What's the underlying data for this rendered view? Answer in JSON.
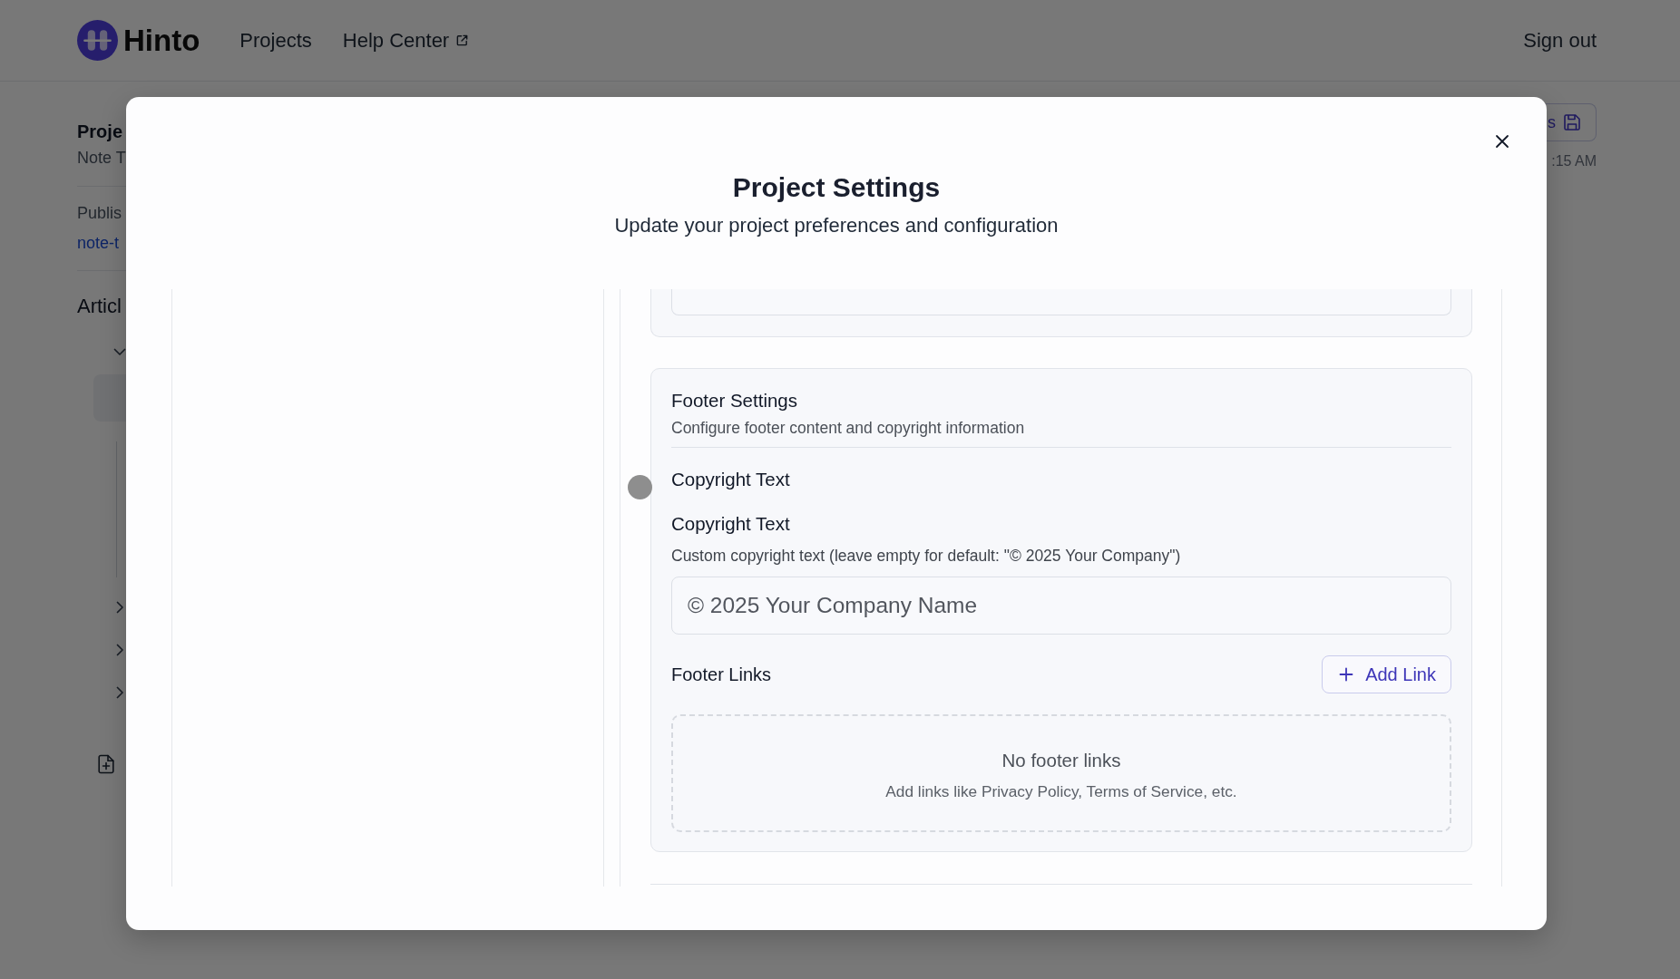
{
  "header": {
    "brand": "Hinto",
    "nav": [
      {
        "label": "Projects",
        "external": false
      },
      {
        "label": "Help Center",
        "external": true
      }
    ],
    "sign_out": "Sign out"
  },
  "background": {
    "sidebar": {
      "project_title": "Proje",
      "project_subtitle": "Note T",
      "published_label": "Publis",
      "published_link": "note-t",
      "articles_heading": "Articl",
      "tree": [
        {
          "expanded": true,
          "children": [
            {
              "selected": true
            }
          ]
        },
        {
          "expanded": false
        },
        {
          "expanded": false
        },
        {
          "expanded": false
        }
      ]
    },
    "save_button": "s",
    "last_saved": ":15 AM"
  },
  "modal": {
    "title": "Project Settings",
    "subtitle": "Update your project preferences and configuration",
    "footer_settings": {
      "title": "Footer Settings",
      "description": "Configure footer content and copyright information",
      "section_label": "Copyright Text",
      "copyright_field": {
        "label": "Copyright Text",
        "help": "Custom copyright text (leave empty for default: \"© 2025 Your Company\")",
        "placeholder": "© 2025 Your Company Name"
      },
      "footer_links": {
        "label": "Footer Links",
        "add_button": "Add Link",
        "empty_title": "No footer links",
        "empty_hint": "Add links like Privacy Policy, Terms of Service, etc."
      }
    }
  }
}
